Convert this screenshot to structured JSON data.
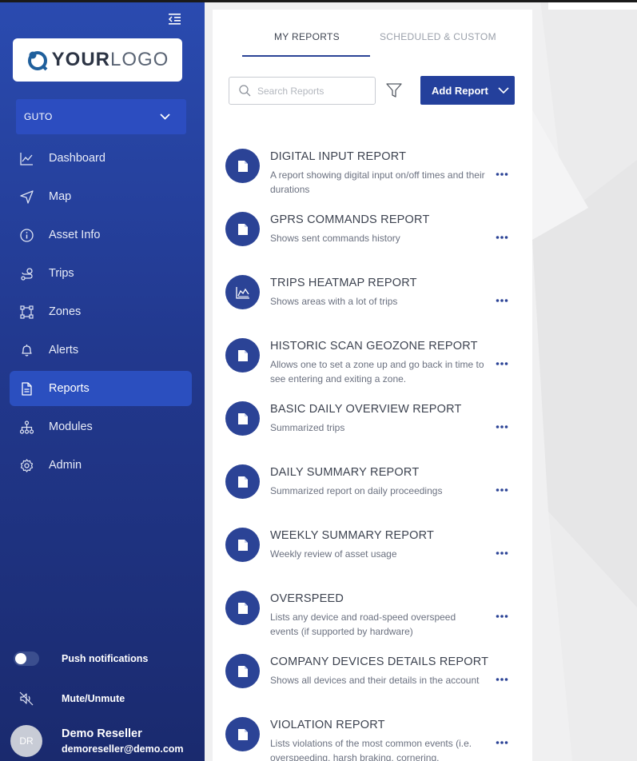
{
  "sidebar": {
    "logo": {
      "bold": "YOUR",
      "light": "LOGO"
    },
    "asset_selector": "GUTO",
    "nav": [
      {
        "label": "Dashboard",
        "icon": "chart-line-icon"
      },
      {
        "label": "Map",
        "icon": "navigation-arrow-icon"
      },
      {
        "label": "Asset Info",
        "icon": "info-circle-icon"
      },
      {
        "label": "Trips",
        "icon": "route-icon"
      },
      {
        "label": "Zones",
        "icon": "polygon-zone-icon"
      },
      {
        "label": "Alerts",
        "icon": "bell-icon"
      },
      {
        "label": "Reports",
        "icon": "document-icon",
        "active": true
      },
      {
        "label": "Modules",
        "icon": "hierarchy-icon"
      },
      {
        "label": "Admin",
        "icon": "gear-icon"
      }
    ],
    "push_notifications": {
      "label": "Push notifications",
      "enabled": false
    },
    "mute": "Mute/Unmute",
    "user": {
      "initials": "DR",
      "name": "Demo Reseller",
      "email": "demoreseller@demo.com"
    }
  },
  "main": {
    "tabs": [
      {
        "label": "MY REPORTS",
        "active": true
      },
      {
        "label": "SCHEDULED & CUSTOM",
        "active": false
      }
    ],
    "search": {
      "placeholder": "Search Reports",
      "value": ""
    },
    "add_button": "Add Report",
    "reports": [
      {
        "title": "DIGITAL INPUT REPORT",
        "description": "A report showing digital input on/off times and their durations",
        "icon": "document-icon"
      },
      {
        "title": "GPRS COMMANDS REPORT",
        "description": "Shows sent commands history",
        "icon": "document-icon"
      },
      {
        "title": "TRIPS HEATMAP REPORT",
        "description": "Shows areas with a lot of trips",
        "icon": "area-chart-icon"
      },
      {
        "title": "HISTORIC SCAN GEOZONE REPORT",
        "description": "Allows one to set a zone up and go back in time to see entering and exiting a zone.",
        "icon": "document-icon"
      },
      {
        "title": "BASIC DAILY OVERVIEW REPORT",
        "description": "Summarized trips",
        "icon": "document-icon"
      },
      {
        "title": "DAILY SUMMARY REPORT",
        "description": "Summarized report on daily proceedings",
        "icon": "document-icon"
      },
      {
        "title": "WEEKLY SUMMARY REPORT",
        "description": "Weekly review of asset usage",
        "icon": "document-icon"
      },
      {
        "title": "OVERSPEED",
        "description": "Lists any device and road-speed overspeed events (if supported by hardware)",
        "icon": "document-icon"
      },
      {
        "title": "COMPANY DEVICES DETAILS REPORT",
        "description": "Shows all devices and their details in the account",
        "icon": "document-icon"
      },
      {
        "title": "VIOLATION REPORT",
        "description": "Lists violations of the most common events (i.e. overspeeding, harsh braking, cornering,",
        "icon": "document-icon"
      }
    ]
  },
  "colors": {
    "primary": "#24409c",
    "sidebar_top": "#2a4bb0",
    "sidebar_bottom": "#1a2a6e",
    "active_nav": "#2b4fbf"
  }
}
